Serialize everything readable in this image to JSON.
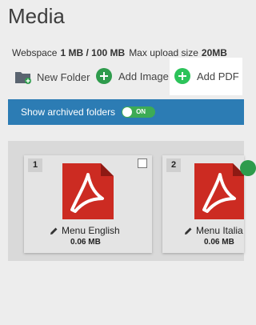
{
  "page": {
    "title": "Media"
  },
  "usage": {
    "webspace_label": "Webspace",
    "webspace_value": "1 MB / 100 MB",
    "upload_label": "Max upload size",
    "upload_value": "20MB"
  },
  "toolbar": {
    "new_folder_label": "New Folder",
    "add_image_label": "Add Image",
    "add_pdf_label": "Add PDF"
  },
  "archive": {
    "label": "Show archived folders",
    "toggle_text": "ON"
  },
  "files": [
    {
      "number": "1",
      "name": "Menu English",
      "size": "0.06 MB"
    },
    {
      "number": "2",
      "name": "Menu Italia",
      "size": "0.06 MB"
    }
  ],
  "colors": {
    "archive_bar": "#2c7cb4",
    "toggle_on": "#3dab55",
    "add_button": "#2e9b4c",
    "pdf_red": "#cc2b22"
  }
}
